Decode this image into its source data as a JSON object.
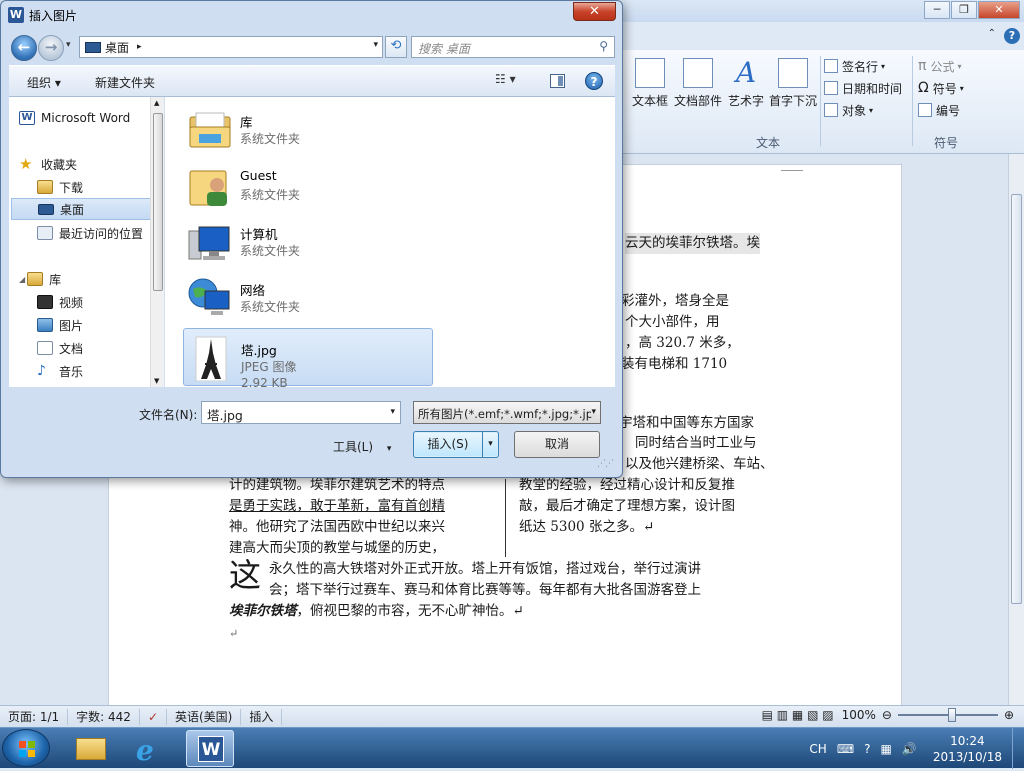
{
  "word": {
    "ribbon": {
      "text_box": "文本框",
      "quick_parts": "文档部件",
      "wordart": "艺术字",
      "drop_cap": "首字下沉",
      "signature_line": "签名行",
      "date_time": "日期和时间",
      "object": "对象",
      "equation": "公式",
      "symbol": "符号",
      "number": "编号",
      "group_text": "文本",
      "group_symbols": "符号"
    },
    "doc_lines": [
      "云天的埃菲尔铁塔。埃",
      "彩灌外，塔身全是",
      "个大小部件，用",
      "，高 320.7 米多，",
      "装有电梯和 1710",
      "宇塔和中国等东方国家",
      "同时结合当时工业与",
      "以及他兴建桥梁、车站、",
      "计的建筑物。埃菲尔建筑艺术的特点",
      "教堂的经验，经过精心设计和反复推",
      "是勇于实践，敢于革新，富有首创精",
      "敲，最后才确定了理想方案，设计图",
      "神。他研究了法国西欧中世纪以来兴",
      "纸达 5300 张之多。↵",
      "建高大而尖顶的教堂与城堡的历史，",
      "永久性的高大铁塔对外正式开放。塔上开有饭馆，搭过戏台，举行过演讲",
      "会；塔下举行过赛车、赛马和体育比赛等等。每年都有大批各国游客登上",
      "，俯视巴黎的市容，无不心旷神怡。↵",
      "↵"
    ],
    "drop_cap": "这",
    "bold_phrase": "埃菲尔铁塔",
    "status": {
      "page": "页面: 1/1",
      "words": "字数: 442",
      "language": "英语(美国)",
      "mode": "插入",
      "zoom": "100%"
    }
  },
  "dialog": {
    "title": "插入图片",
    "address": "桌面",
    "search_placeholder": "搜索 桌面",
    "organize": "组织 ▾",
    "new_folder": "新建文件夹",
    "nav": {
      "word": "Microsoft Word",
      "favorites": "收藏夹",
      "downloads": "下载",
      "desktop": "桌面",
      "recent": "最近访问的位置",
      "libraries": "库",
      "videos": "视频",
      "pictures": "图片",
      "documents": "文档",
      "music": "音乐"
    },
    "files": [
      {
        "name": "库",
        "type": "系统文件夹"
      },
      {
        "name": "Guest",
        "type": "系统文件夹"
      },
      {
        "name": "计算机",
        "type": "系统文件夹"
      },
      {
        "name": "网络",
        "type": "系统文件夹"
      },
      {
        "name": "塔.jpg",
        "type": "JPEG 图像",
        "size": "2.92 KB"
      }
    ],
    "filename_label": "文件名(N):",
    "filename_value": "塔.jpg",
    "filter": "所有图片(*.emf;*.wmf;*.jpg;*.jp",
    "tools": "工具(L)",
    "insert": "插入(S)",
    "cancel": "取消"
  },
  "taskbar": {
    "lang": "CH",
    "time": "10:24",
    "date": "2013/10/18"
  }
}
